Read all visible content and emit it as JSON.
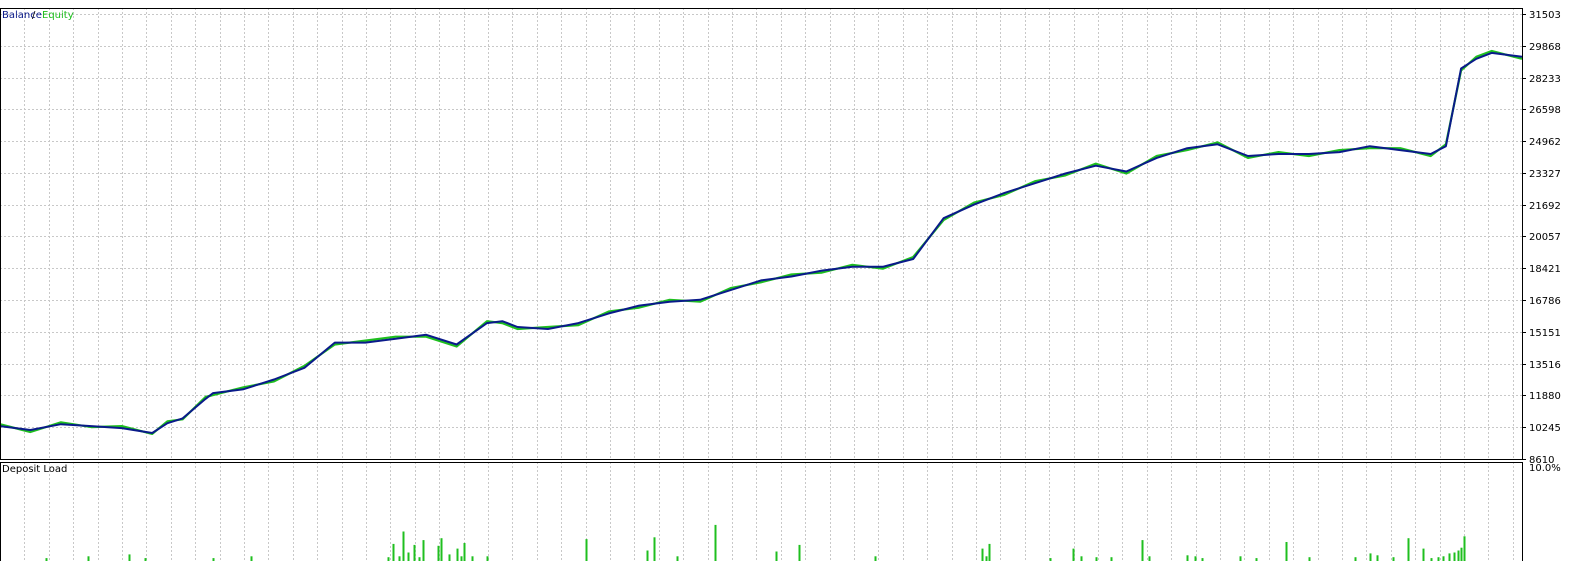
{
  "colors": {
    "balance": "#0a1a8a",
    "equity": "#1fbf1f",
    "deposit_load": "#1fbf1f",
    "grid": "#c8c8c8",
    "frame": "#000000",
    "background": "#ffffff",
    "text": "#000000"
  },
  "chart_data": [
    {
      "type": "line",
      "legend": {
        "balance": "Balance",
        "separator": " / ",
        "equity": "Equity"
      },
      "legend_position": "top-left",
      "ylim": [
        8610,
        31503
      ],
      "y_ticks": [
        "31503",
        "29868",
        "28233",
        "26598",
        "24962",
        "23327",
        "21692",
        "20057",
        "18421",
        "16786",
        "15151",
        "13516",
        "11880",
        "10245",
        "8610"
      ],
      "x_range": [
        0,
        1000
      ],
      "grid": true,
      "series": [
        {
          "name": "Balance",
          "color": "#0a1a8a",
          "x": [
            0,
            20,
            40,
            60,
            80,
            100,
            110,
            120,
            135,
            140,
            160,
            180,
            200,
            220,
            240,
            260,
            280,
            300,
            320,
            330,
            340,
            360,
            380,
            400,
            420,
            440,
            460,
            480,
            500,
            520,
            540,
            560,
            580,
            600,
            620,
            640,
            660,
            680,
            700,
            720,
            740,
            760,
            780,
            800,
            820,
            840,
            860,
            880,
            900,
            920,
            940,
            950,
            960,
            970,
            980,
            1000
          ],
          "y": [
            10300,
            10100,
            10400,
            10300,
            10200,
            9950,
            10450,
            10700,
            11700,
            12000,
            12200,
            12700,
            13300,
            14600,
            14600,
            14800,
            15000,
            14500,
            15600,
            15700,
            15400,
            15300,
            15600,
            16100,
            16500,
            16700,
            16800,
            17300,
            17800,
            18000,
            18300,
            18500,
            18500,
            18900,
            21000,
            21700,
            22300,
            22800,
            23300,
            23700,
            23400,
            24100,
            24600,
            24800,
            24200,
            24300,
            24300,
            24400,
            24700,
            24500,
            24300,
            24700,
            28700,
            29200,
            29500,
            29300
          ]
        },
        {
          "name": "Equity",
          "color": "#1fbf1f",
          "x": [
            0,
            20,
            40,
            60,
            80,
            100,
            110,
            120,
            135,
            140,
            160,
            180,
            200,
            220,
            240,
            260,
            280,
            300,
            320,
            330,
            340,
            360,
            380,
            400,
            420,
            440,
            460,
            480,
            500,
            520,
            540,
            560,
            580,
            600,
            620,
            640,
            660,
            680,
            700,
            720,
            740,
            760,
            780,
            800,
            820,
            840,
            860,
            880,
            900,
            920,
            940,
            950,
            960,
            970,
            980,
            1000
          ],
          "y": [
            10400,
            10000,
            10500,
            10250,
            10300,
            9900,
            10550,
            10650,
            11800,
            11900,
            12300,
            12600,
            13400,
            14500,
            14700,
            14900,
            14900,
            14400,
            15700,
            15600,
            15300,
            15400,
            15500,
            16200,
            16400,
            16800,
            16700,
            17400,
            17700,
            18100,
            18200,
            18600,
            18400,
            19000,
            20900,
            21800,
            22200,
            22900,
            23200,
            23800,
            23300,
            24200,
            24500,
            24900,
            24100,
            24400,
            24200,
            24500,
            24600,
            24600,
            24200,
            24800,
            28600,
            29300,
            29600,
            29200
          ]
        }
      ]
    },
    {
      "type": "bar",
      "title": "Deposit Load",
      "ylim": [
        0,
        10
      ],
      "y_ticks": [
        "10.0%"
      ],
      "x_range": [
        0,
        1000
      ],
      "grid": true,
      "series": [
        {
          "name": "Deposit Load",
          "x": [
            30,
            58,
            85,
            95,
            140,
            165,
            255,
            258,
            262,
            265,
            268,
            272,
            275,
            278,
            288,
            290,
            295,
            300,
            303,
            305,
            310,
            320,
            385,
            425,
            430,
            445,
            470,
            510,
            525,
            575,
            645,
            648,
            650,
            690,
            705,
            710,
            720,
            730,
            750,
            755,
            780,
            785,
            790,
            815,
            825,
            845,
            860,
            890,
            900,
            905,
            915,
            925,
            935,
            940,
            945,
            948,
            952,
            955,
            958,
            960,
            962
          ],
          "values": [
            0.3,
            0.5,
            0.7,
            0.3,
            0.3,
            0.5,
            0.4,
            1.8,
            0.5,
            3.1,
            0.9,
            1.7,
            0.4,
            2.2,
            1.6,
            2.4,
            0.7,
            1.3,
            0.5,
            1.9,
            0.5,
            0.5,
            2.3,
            1.1,
            2.5,
            0.5,
            3.8,
            1.0,
            1.7,
            0.5,
            1.3,
            0.5,
            1.8,
            0.3,
            1.3,
            0.5,
            0.4,
            0.4,
            2.2,
            0.5,
            0.6,
            0.5,
            0.3,
            0.5,
            0.3,
            2.0,
            0.4,
            0.4,
            0.8,
            0.6,
            0.4,
            2.4,
            1.3,
            0.3,
            0.4,
            0.5,
            0.8,
            0.9,
            1.1,
            1.4,
            2.6
          ]
        }
      ]
    }
  ]
}
